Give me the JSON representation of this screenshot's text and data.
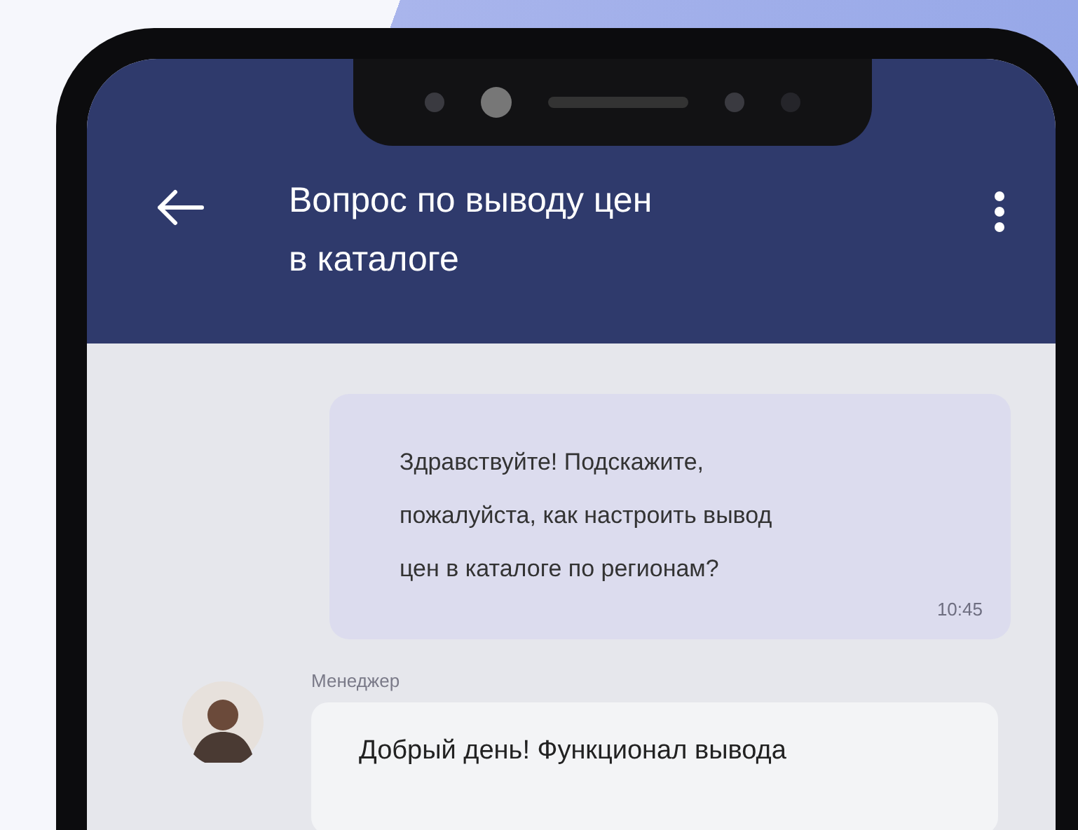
{
  "header": {
    "title_lines": [
      "Вопрос по выводу цен",
      "в каталоге"
    ]
  },
  "messages": [
    {
      "kind": "outgoing",
      "text": "Здравствуйте! Подскажите,\nпожалуйста, как настроить вывод\nцен в каталоге по регионам?",
      "time": "10:45"
    },
    {
      "kind": "incoming",
      "sender": "Менеджер",
      "text": "Добрый день! Функционал вывода"
    }
  ]
}
